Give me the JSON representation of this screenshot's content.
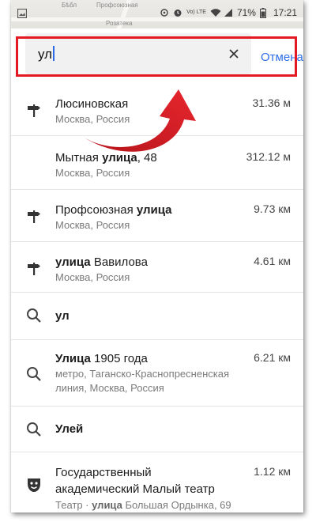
{
  "status_bar": {
    "map_labels": [
      "Бѣбл",
      "Профсоюзная",
      "Розатека"
    ],
    "network": "Vo) LTE",
    "battery": "71%",
    "time": "17:21"
  },
  "search": {
    "value": "ул",
    "cancel_label": "Отмена"
  },
  "results": [
    {
      "icon": "signpost-icon",
      "title_plain": "Люсиновская",
      "title_bold": "",
      "sub": "Москва, Россия",
      "dist": "31.36 м"
    },
    {
      "icon": "none",
      "title_plain": "Мытная ",
      "title_bold": "улица",
      "title_after": ", 48",
      "sub": "Москва, Россия",
      "dist": "312.12 м"
    },
    {
      "icon": "signpost-icon",
      "title_plain": "Профсоюзная ",
      "title_bold": "улица",
      "sub": "Москва, Россия",
      "dist": "9.73 км"
    },
    {
      "icon": "signpost-icon",
      "title_bold": "улица",
      "title_after": " Вавилова",
      "sub": "Москва, Россия",
      "dist": "4.61 км"
    },
    {
      "icon": "search-icon",
      "title_bold": "ул"
    },
    {
      "icon": "search-icon",
      "title_bold": "Улица",
      "title_after": " 1905 года",
      "sub": "метро, Таганско-Краснопресненская линия, Москва, Россия",
      "dist": "6.21 км"
    },
    {
      "icon": "search-icon",
      "title_bold": "Улей"
    },
    {
      "icon": "theater-mask-icon",
      "title_line1": "Государственный",
      "title_line2": "академический Малый театр",
      "sub_pre": "Театр · ",
      "sub_bold": "улица",
      "sub_post": " Большая Ордынка, 69",
      "dist": "1.12 км"
    }
  ]
}
